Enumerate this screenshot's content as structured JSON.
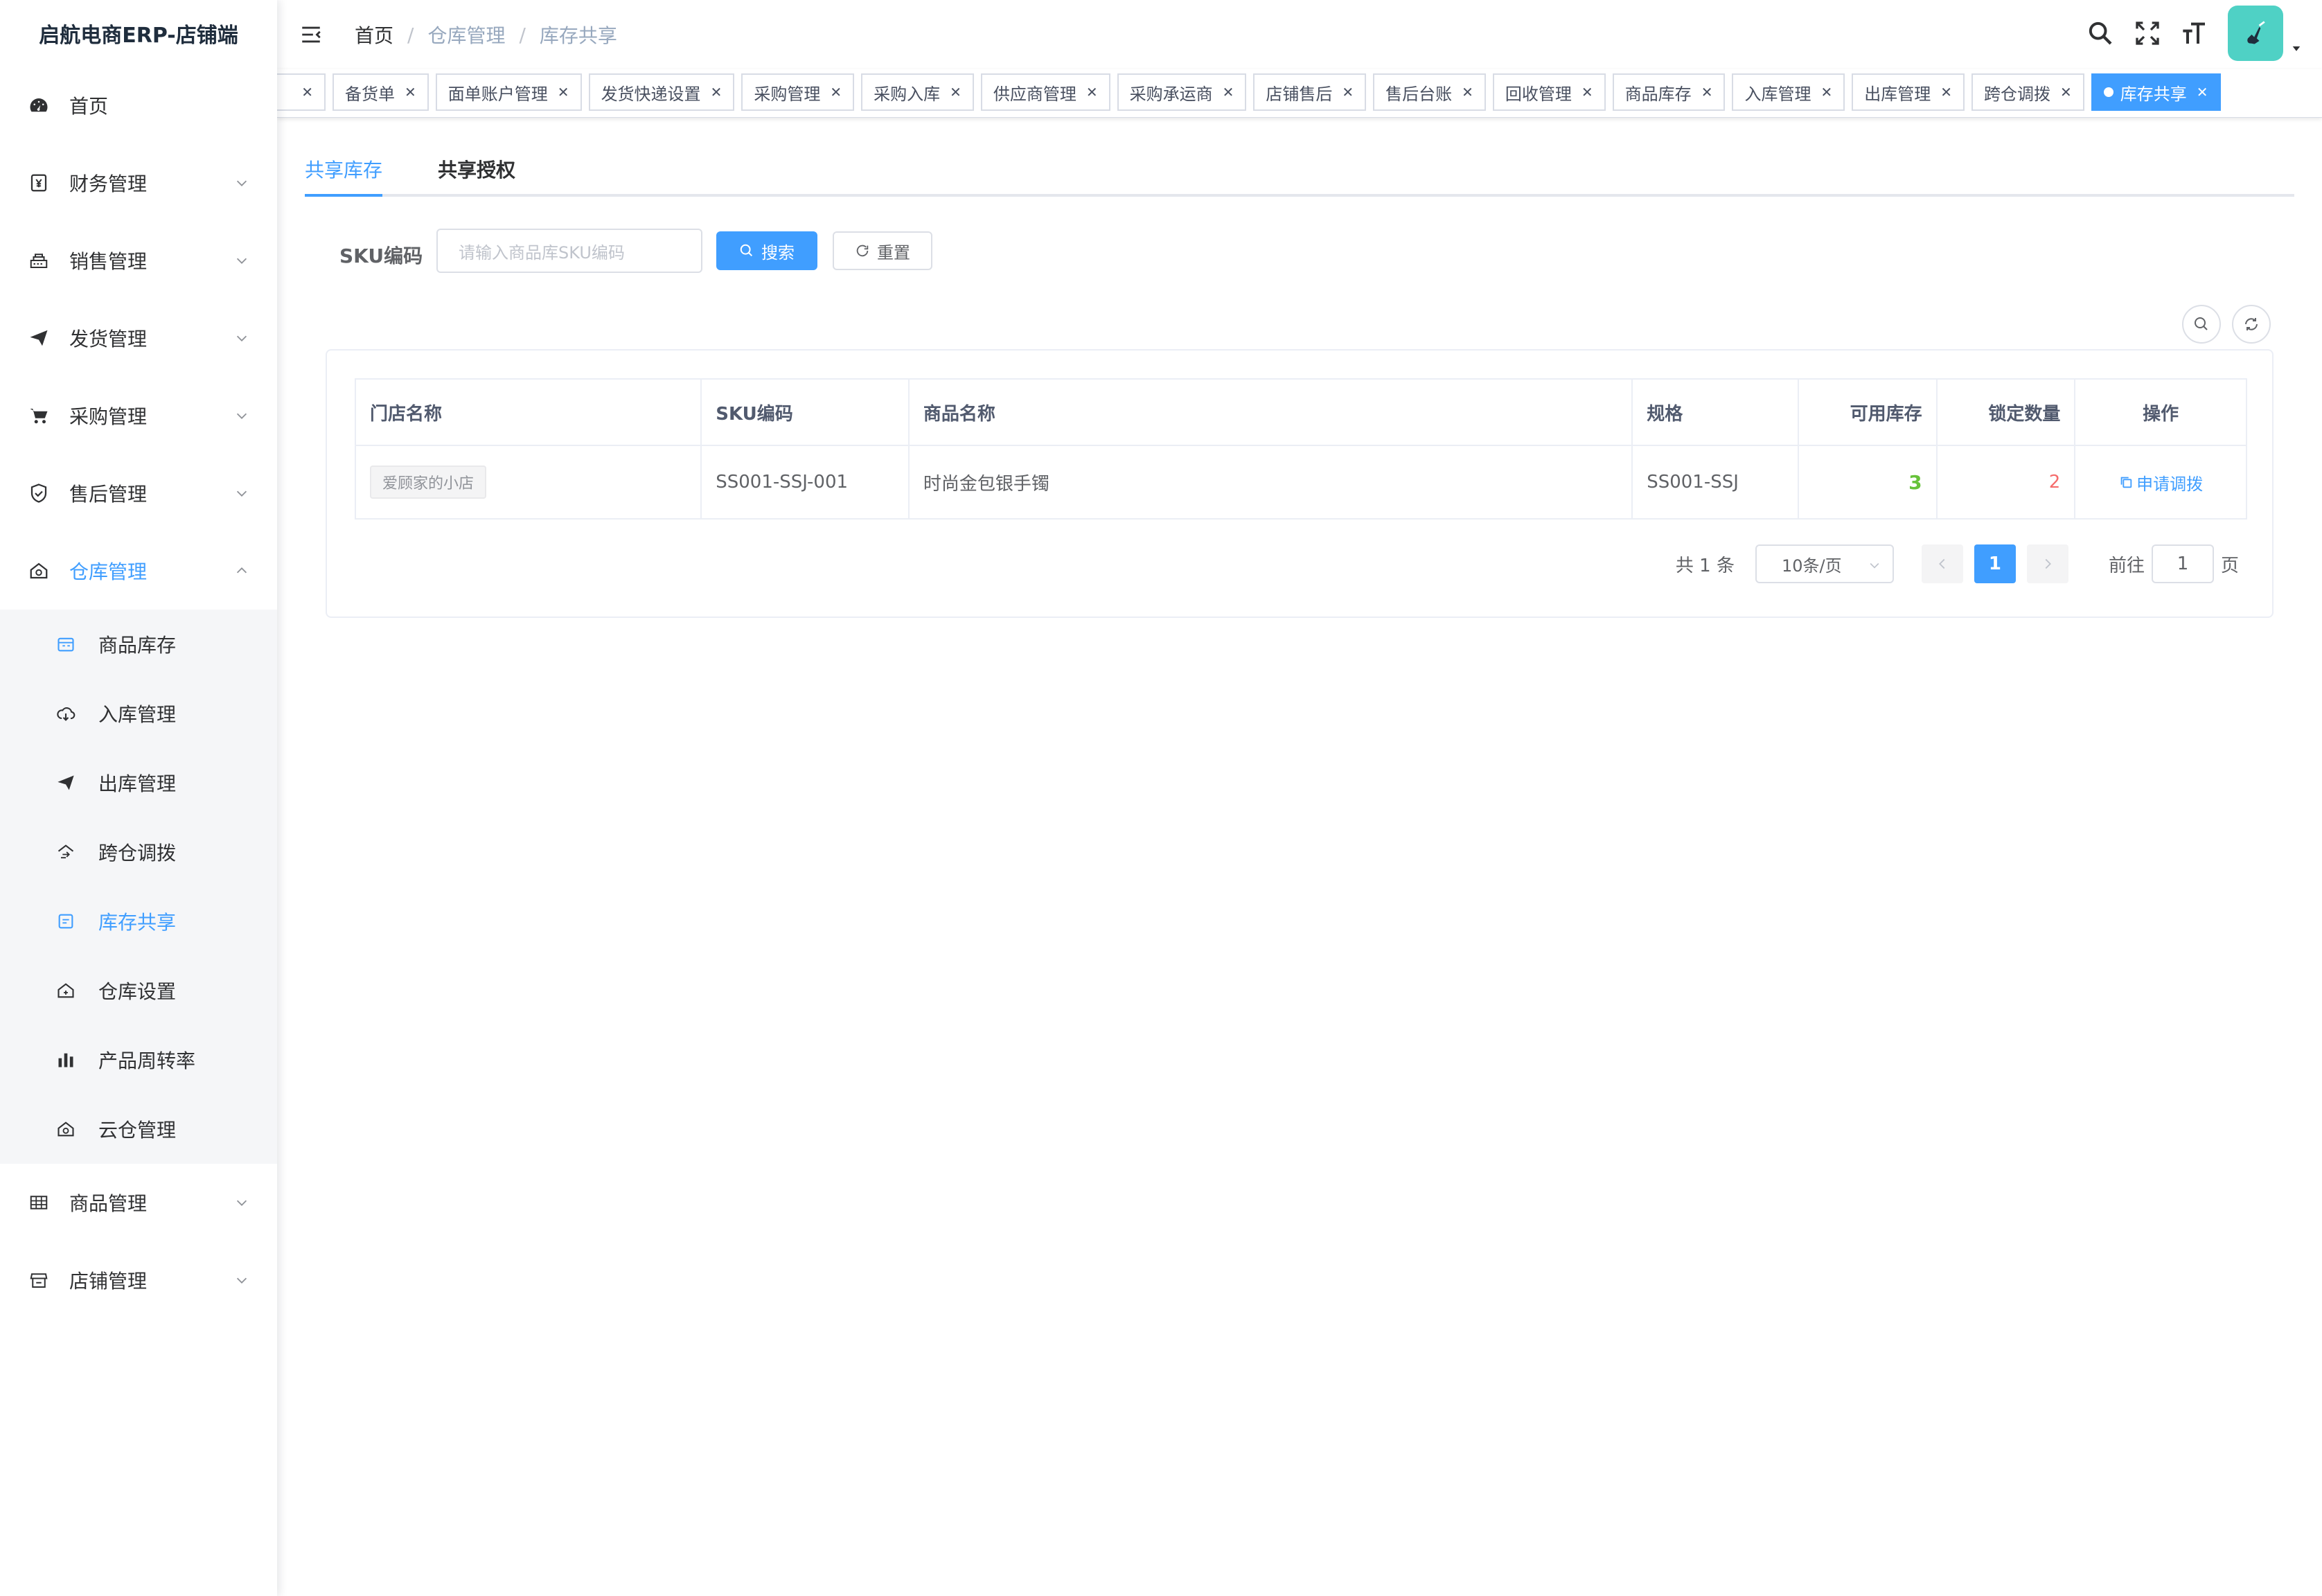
{
  "app": {
    "title": "启航电商ERP-店铺端"
  },
  "sidebar": {
    "items": [
      {
        "label": "首页",
        "icon": "dashboard-icon"
      },
      {
        "label": "财务管理",
        "icon": "finance-icon"
      },
      {
        "label": "销售管理",
        "icon": "sales-icon"
      },
      {
        "label": "发货管理",
        "icon": "send-icon"
      },
      {
        "label": "采购管理",
        "icon": "cart-icon"
      },
      {
        "label": "售后管理",
        "icon": "shield-icon"
      },
      {
        "label": "仓库管理",
        "icon": "warehouse-icon"
      },
      {
        "label": "商品管理",
        "icon": "table-icon"
      },
      {
        "label": "店铺管理",
        "icon": "shop-icon"
      }
    ],
    "warehouse_sub": [
      {
        "label": "商品库存",
        "icon": "inventory-icon"
      },
      {
        "label": "入库管理",
        "icon": "upload-icon"
      },
      {
        "label": "出库管理",
        "icon": "send-icon"
      },
      {
        "label": "跨仓调拨",
        "icon": "transfer-icon"
      },
      {
        "label": "库存共享",
        "icon": "share-icon"
      },
      {
        "label": "仓库设置",
        "icon": "settings-house-icon"
      },
      {
        "label": "产品周转率",
        "icon": "bar-chart-icon"
      },
      {
        "label": "云仓管理",
        "icon": "cloud-house-icon"
      }
    ]
  },
  "navbar": {
    "breadcrumb": [
      "首页",
      "仓库管理",
      "库存共享"
    ],
    "separator": "/"
  },
  "tags": [
    {
      "label": "备货单"
    },
    {
      "label": "面单账户管理"
    },
    {
      "label": "发货快递设置"
    },
    {
      "label": "采购管理"
    },
    {
      "label": "采购入库"
    },
    {
      "label": "供应商管理"
    },
    {
      "label": "采购承运商"
    },
    {
      "label": "店铺售后"
    },
    {
      "label": "售后台账"
    },
    {
      "label": "回收管理"
    },
    {
      "label": "商品库存"
    },
    {
      "label": "入库管理"
    },
    {
      "label": "出库管理"
    },
    {
      "label": "跨仓调拨"
    },
    {
      "label": "库存共享"
    }
  ],
  "tabs": [
    "共享库存",
    "共享授权"
  ],
  "search": {
    "label": "SKU编码",
    "placeholder": "请输入商品库SKU编码",
    "search_btn": "搜索",
    "reset_btn": "重置"
  },
  "table": {
    "headers": [
      "门店名称",
      "SKU编码",
      "商品名称",
      "规格",
      "可用库存",
      "锁定数量",
      "操作"
    ],
    "rows": [
      {
        "store": "爱顾家的小店",
        "sku": "SS001-SSJ-001",
        "name": "时尚金包银手镯",
        "spec": "SS001-SSJ",
        "available": "3",
        "locked": "2",
        "action": "申请调拨"
      }
    ]
  },
  "pagination": {
    "total": "共 1 条",
    "page_size": "10条/页",
    "current": "1",
    "goto_prefix": "前往",
    "goto_value": "1",
    "goto_suffix": "页"
  },
  "colors": {
    "primary": "#409eff",
    "green": "#67c23a",
    "red": "#f56c6c"
  }
}
